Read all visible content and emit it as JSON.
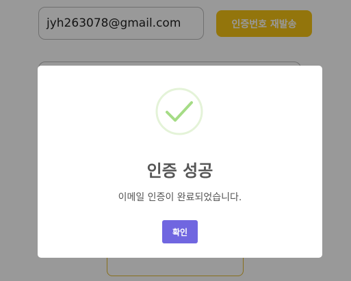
{
  "form": {
    "email_value": "jyh263078@gmail.com",
    "resend_label": "인증번호 재발송"
  },
  "modal": {
    "icon": "success-check-icon",
    "title": "인증 성공",
    "text": "이메일 인증이 완료되었습니다.",
    "confirm_label": "확인"
  },
  "colors": {
    "accent": "#7066e0",
    "resend_button": "#f5c314",
    "success_ring": "#e4f3d8",
    "success_check": "#a5dc86"
  }
}
